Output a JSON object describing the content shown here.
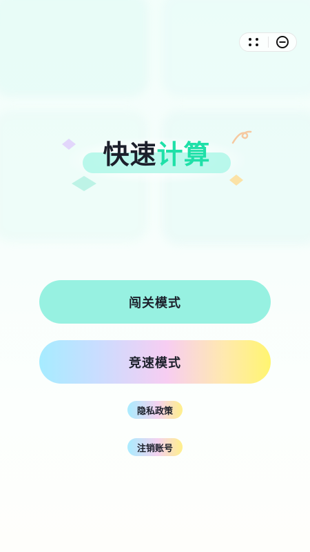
{
  "capsule": {
    "more_icon": "dots-icon",
    "close_icon": "circle-minus-icon"
  },
  "title": {
    "part1": "快速",
    "part2": "计算"
  },
  "buttons": {
    "stage_mode": "闯关模式",
    "race_mode": "竞速模式"
  },
  "links": {
    "privacy_policy": "隐私政策",
    "cancel_account": "注销账号"
  },
  "colors": {
    "title_dark": "#1c1f2b",
    "title_accent": "#1fe0a8",
    "stage_button": "#97f1e1",
    "race_gradient_start": "#a6ecff",
    "race_gradient_end": "#fff570"
  }
}
